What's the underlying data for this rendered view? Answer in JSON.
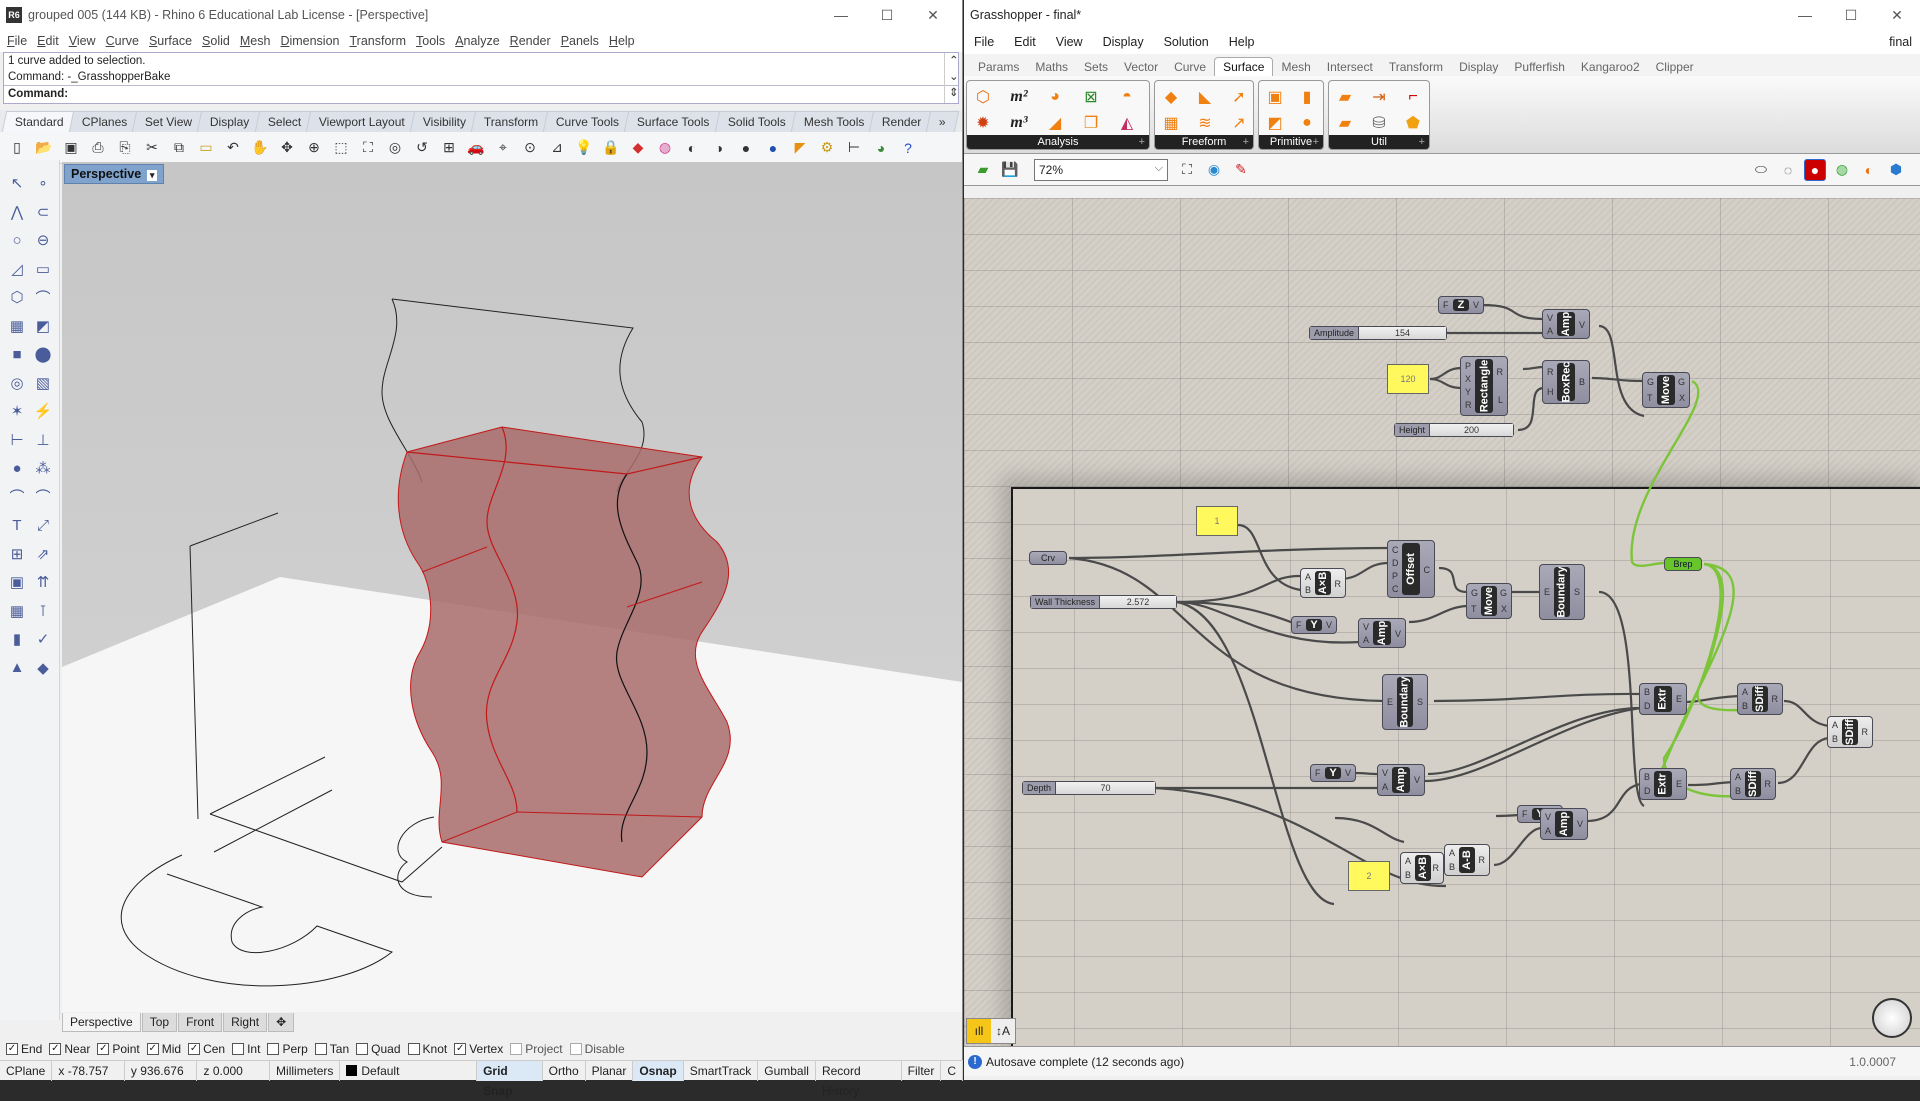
{
  "rhino": {
    "title": "grouped 005 (144 KB) - Rhino 6 Educational Lab License - [Perspective]",
    "app_icon": "rhino-6-logo",
    "menu": [
      "File",
      "Edit",
      "View",
      "Curve",
      "Surface",
      "Solid",
      "Mesh",
      "Dimension",
      "Transform",
      "Tools",
      "Analyze",
      "Render",
      "Panels",
      "Help"
    ],
    "command_history": [
      "1 curve added to selection.",
      "Command: -_GrasshopperBake"
    ],
    "command_prompt": "Command:",
    "toolbar_tabs": [
      "Standard",
      "CPlanes",
      "Set View",
      "Display",
      "Select",
      "Viewport Layout",
      "Visibility",
      "Transform",
      "Curve Tools",
      "Surface Tools",
      "Solid Tools",
      "Mesh Tools",
      "Render"
    ],
    "toolbar_tabs_overflow": "»",
    "active_toolbar_tab": "Standard",
    "standard_icons": [
      "new-icon",
      "open-icon",
      "save-icon",
      "print-icon",
      "import-icon",
      "cut-icon",
      "copy-icon",
      "paste-icon",
      "undo-icon",
      "pan-icon",
      "rotate-icon",
      "zoom-icon",
      "zoom-window-icon",
      "zoom-extents-icon",
      "zoom-selected-icon",
      "undo-view-icon",
      "four-viewports-icon",
      "car-icon",
      "cplane-icon",
      "circle-point-icon",
      "osnap-icon",
      "light-icon",
      "lock-icon",
      "layer-icon",
      "color-wheel-icon",
      "sphere-wire-icon",
      "sphere-shaded-icon",
      "sphere-render-icon",
      "blue-sphere-icon",
      "render-icon",
      "options-gear-icon",
      "dimension-icon",
      "grasshopper-icon",
      "help-icon"
    ],
    "viewport": {
      "label": "Perspective",
      "dropdown": "▾",
      "tabs": [
        "Perspective",
        "Top",
        "Front",
        "Right"
      ],
      "add_tab": "✥",
      "active_tab": "Perspective"
    },
    "osnaps": [
      {
        "label": "End",
        "checked": true
      },
      {
        "label": "Near",
        "checked": true
      },
      {
        "label": "Point",
        "checked": true
      },
      {
        "label": "Mid",
        "checked": true
      },
      {
        "label": "Cen",
        "checked": true
      },
      {
        "label": "Int",
        "checked": false
      },
      {
        "label": "Perp",
        "checked": false
      },
      {
        "label": "Tan",
        "checked": false
      },
      {
        "label": "Quad",
        "checked": false
      },
      {
        "label": "Knot",
        "checked": false
      },
      {
        "label": "Vertex",
        "checked": true
      },
      {
        "label": "Project",
        "checked": false,
        "disabled": true
      },
      {
        "label": "Disable",
        "checked": false,
        "disabled": true
      }
    ],
    "status": {
      "cplane": "CPlane",
      "x": "x -78.757",
      "y": "y 936.676",
      "z": "z 0.000",
      "units": "Millimeters",
      "layer": "Default",
      "layer_color": "#000000",
      "toggles": [
        "Grid Snap",
        "Ortho",
        "Planar",
        "Osnap",
        "SmartTrack",
        "Gumball",
        "Record History",
        "Filter",
        "C"
      ],
      "bold_toggles": [
        "Grid Snap",
        "Osnap"
      ]
    },
    "model_color": "#b06060"
  },
  "grasshopper": {
    "title": "Grasshopper - final*",
    "doc_name": "final",
    "menu": [
      "File",
      "Edit",
      "View",
      "Display",
      "Solution",
      "Help"
    ],
    "tabs": [
      "Params",
      "Maths",
      "Sets",
      "Vector",
      "Curve",
      "Surface",
      "Mesh",
      "Intersect",
      "Transform",
      "Display",
      "Pufferfish",
      "Kangaroo2",
      "Clipper"
    ],
    "active_tab": "Surface",
    "ribbon_groups": [
      {
        "label": "Analysis",
        "icons": [
          "box-analysis-icon",
          "area-m2-icon",
          "centroid-icon",
          "point-in-brep-icon",
          "surface-point-icon",
          "brep-wireframe-icon",
          "volume-m3-icon",
          "evaluate-icon",
          "brep-closest-icon",
          "surface-curvature-icon"
        ]
      },
      {
        "label": "Freeform",
        "icons": [
          "4point-surface-icon",
          "boundary-surface-icon",
          "extrude-icon",
          "surface-grid-icon",
          "network-surface-icon",
          "sweep-icon"
        ]
      },
      {
        "label": "Primitive",
        "icons": [
          "box-icon",
          "cylinder-icon",
          "box-rect-icon",
          "sphere-icon"
        ]
      },
      {
        "label": "Util",
        "icons": [
          "divide-surface-icon",
          "offset-surface-icon",
          "edges-icon",
          "isotrim-icon",
          "cap-holes-icon",
          "brep-join-icon"
        ]
      }
    ],
    "zoom": "72%",
    "canvas_toolbar_icons": [
      "open-file-icon",
      "save-file-icon",
      "zoom-extents-icon",
      "preview-eye-icon",
      "sketch-pencil-icon"
    ],
    "preview_icons": [
      "preview-wire-icon",
      "preview-mesh-icon",
      "preview-shaded-icon",
      "preview-selected-icon",
      "preview-material-icon",
      "sphere-preview-icon"
    ],
    "status": "Autosave complete (12 seconds ago)",
    "version": "1.0.0007",
    "nodes": {
      "unit_z": {
        "name": "Z",
        "inputs": [
          "F"
        ],
        "outputs": [
          "V"
        ]
      },
      "amplitude_slider": {
        "label": "Amplitude",
        "value": "154"
      },
      "amp_top": {
        "name": "Amp",
        "inputs": [
          "V",
          "A"
        ],
        "outputs": [
          "V"
        ]
      },
      "panel_120": {
        "value": "120"
      },
      "rectangle": {
        "name": "Rectangle",
        "inputs": [
          "P",
          "X",
          "Y",
          "R"
        ],
        "outputs": [
          "R",
          "L"
        ]
      },
      "boxrec": {
        "name": "BoxRec",
        "inputs": [
          "R",
          "H"
        ],
        "outputs": [
          "B"
        ]
      },
      "move_top": {
        "name": "Move",
        "inputs": [
          "G",
          "T"
        ],
        "outputs": [
          "G",
          "X"
        ]
      },
      "height_slider": {
        "label": "Height",
        "value": "200"
      },
      "brep": {
        "name": "Brep"
      },
      "panel_1": {
        "value": "1"
      },
      "crv": {
        "name": "Crv"
      },
      "wall_slider": {
        "label": "Wall Thickness",
        "value": "2.572"
      },
      "mult_1": {
        "name": "A×B",
        "inputs": [
          "A",
          "B"
        ],
        "outputs": [
          "R"
        ]
      },
      "offset": {
        "name": "Offset",
        "inputs": [
          "C",
          "D",
          "P",
          "C"
        ],
        "outputs": [
          "C"
        ]
      },
      "move_mid": {
        "name": "Move",
        "inputs": [
          "G",
          "T"
        ],
        "outputs": [
          "G",
          "X"
        ]
      },
      "boundary_1": {
        "name": "Boundary",
        "inputs": [
          "E"
        ],
        "outputs": [
          "S"
        ]
      },
      "unit_y_1": {
        "name": "Y",
        "inputs": [
          "F"
        ],
        "outputs": [
          "V"
        ]
      },
      "amp_1": {
        "name": "Amp",
        "inputs": [
          "V",
          "A"
        ],
        "outputs": [
          "V"
        ]
      },
      "boundary_2": {
        "name": "Boundary",
        "inputs": [
          "E"
        ],
        "outputs": [
          "S"
        ]
      },
      "extr_1": {
        "name": "Extr",
        "inputs": [
          "B",
          "D"
        ],
        "outputs": [
          "E"
        ]
      },
      "sdiff_1": {
        "name": "SDiff",
        "inputs": [
          "A",
          "B"
        ],
        "outputs": [
          "R"
        ]
      },
      "sdiff_final": {
        "name": "SDiff",
        "inputs": [
          "A",
          "B"
        ],
        "outputs": [
          "R"
        ]
      },
      "depth_slider": {
        "label": "Depth",
        "value": "70"
      },
      "unit_y_2": {
        "name": "Y",
        "inputs": [
          "F"
        ],
        "outputs": [
          "V"
        ]
      },
      "amp_2": {
        "name": "Amp",
        "inputs": [
          "V",
          "A"
        ],
        "outputs": [
          "V"
        ]
      },
      "extr_2": {
        "name": "Extr",
        "inputs": [
          "B",
          "D"
        ],
        "outputs": [
          "E"
        ]
      },
      "sdiff_2": {
        "name": "SDiff",
        "inputs": [
          "A",
          "B"
        ],
        "outputs": [
          "R"
        ]
      },
      "unit_y_3": {
        "name": "Y",
        "inputs": [
          "F"
        ],
        "outputs": [
          "V"
        ]
      },
      "amp_3": {
        "name": "Amp",
        "inputs": [
          "V",
          "A"
        ],
        "outputs": [
          "V"
        ]
      },
      "panel_2": {
        "value": "2"
      },
      "mult_2": {
        "name": "A×B",
        "inputs": [
          "A",
          "B"
        ],
        "outputs": [
          "R"
        ]
      },
      "sub": {
        "name": "A-B",
        "inputs": [
          "A",
          "B"
        ],
        "outputs": [
          "R"
        ]
      }
    }
  },
  "window_controls": {
    "minimize": "—",
    "maximize": "☐",
    "close": "✕"
  }
}
